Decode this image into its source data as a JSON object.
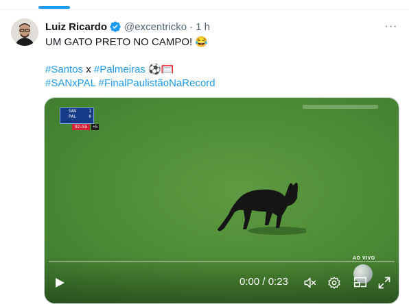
{
  "tweet": {
    "author": {
      "display_name": "Luiz Ricardo",
      "handle": "@excentricko",
      "separator": "·",
      "time": "1 h",
      "verified": true
    },
    "text_line1": "UM GATO PRETO NO CAMPO! 😂",
    "hashtag_santos": "#Santos",
    "versus": " x ",
    "hashtag_palmeiras": "#Palmeiras",
    "emojis": " ⚽🥅",
    "hashtag_sanxpal": "#SANxPAL",
    "hashtag_final": "#FinalPaulistãoNaRecord",
    "more_label": "···"
  },
  "video": {
    "scoreboard": {
      "team1": "SAN",
      "score1": "1",
      "team2": "PAL",
      "score2": "0",
      "clock": "92:55",
      "added_time": "+5"
    },
    "live_label": "AO VIVO",
    "time_display": "0:00 / 0:23",
    "progress_fraction": 0
  },
  "colors": {
    "accent": "#1d9bf0",
    "text": "#0f1419",
    "secondary_text": "#536471",
    "field_green": "#4c8a35"
  },
  "icons": {
    "verified": "verified-badge-icon",
    "more": "more-options-icon",
    "play": "play-icon",
    "volume": "mute-icon",
    "settings": "gear-icon",
    "pip": "picture-in-picture-icon",
    "fullscreen": "fullscreen-icon"
  }
}
